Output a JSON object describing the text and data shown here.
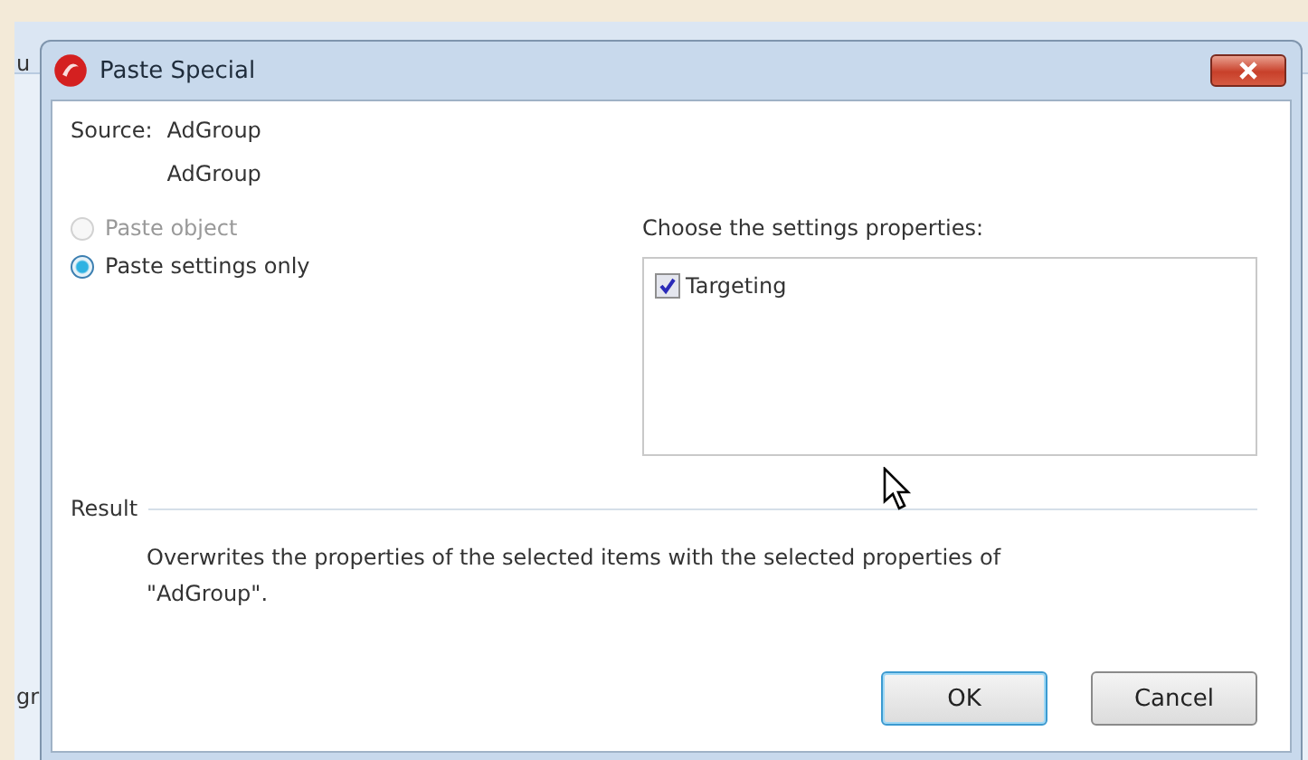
{
  "background_app": {
    "fragments": [
      "u",
      "gr"
    ]
  },
  "window": {
    "title": "Paste Special"
  },
  "source": {
    "label": "Source:",
    "values": [
      "AdGroup",
      "AdGroup"
    ]
  },
  "paste_options": [
    {
      "label": "Paste object",
      "selected": false,
      "disabled": true
    },
    {
      "label": "Paste settings only",
      "selected": true,
      "disabled": false
    }
  ],
  "properties": {
    "label": "Choose the settings properties:",
    "items": [
      {
        "label": "Targeting",
        "checked": true
      }
    ]
  },
  "result": {
    "label": "Result",
    "text": "Overwrites the properties of the selected items with the selected properties of \"AdGroup\"."
  },
  "buttons": [
    {
      "label": "OK",
      "kind": "default"
    },
    {
      "label": "Cancel",
      "kind": "normal"
    }
  ]
}
